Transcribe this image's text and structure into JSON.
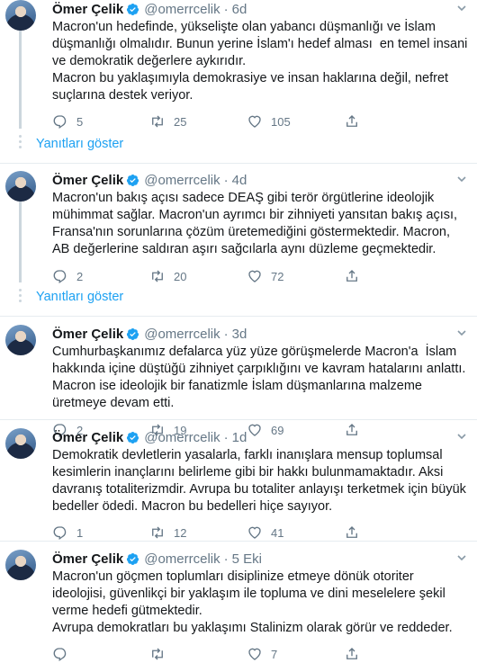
{
  "user": {
    "name": "Ömer Çelik",
    "handle": "@omerrcelik"
  },
  "show_replies_label": "Yanıtları göster",
  "tweets": [
    {
      "time": "6d",
      "text": "Macron'un hedefinde, yükselişte olan yabancı düşmanlığı ve İslam düşmanlığı olmalıdır. Bunun yerine İslam'ı hedef alması  en temel insani ve demokratik değerlere aykırıdır.\nMacron bu yaklaşımıyla demokrasiye ve insan haklarına değil, nefret suçlarına destek veriyor.",
      "replies": "5",
      "retweets": "25",
      "likes": "105"
    },
    {
      "time": "4d",
      "text": "Macron'un bakış açısı sadece DEAŞ gibi terör örgütlerine ideolojik mühimmat sağlar. Macron'un ayrımcı bir zihniyeti yansıtan bakış açısı, Fransa'nın sorunlarına çözüm üretemediğini göstermektedir. Macron, AB değerlerine saldıran aşırı sağcılarla aynı düzleme geçmektedir.",
      "replies": "2",
      "retweets": "20",
      "likes": "72"
    },
    {
      "time": "3d",
      "text": "Cumhurbaşkanımız defalarca yüz yüze görüşmelerde Macron'a  İslam hakkında içine düştüğü zihniyet çarpıklığını ve kavram hatalarını anlattı. Macron ise ideolojik bir fanatizmle İslam düşmanlarına malzeme üretmeye devam etti.",
      "replies": "2",
      "retweets": "19",
      "likes": "69"
    },
    {
      "time": "1d",
      "text": "Demokratik devletlerin yasalarla, farklı inanışlara mensup toplumsal kesimlerin inançlarını belirleme gibi bir hakkı bulunmamaktadır. Aksi davranış totaliterizmdir. Avrupa bu totaliter anlayışı terketmek için büyük bedeller ödedi. Macron bu bedelleri hiçe sayıyor.",
      "replies": "1",
      "retweets": "12",
      "likes": "41"
    },
    {
      "time": "5 Eki",
      "text": "Macron'un göçmen toplumları disiplinize etmeye dönük otoriter ideolojisi, güvenlikçi bir yaklaşım ile topluma ve dini meselelere şekil verme hedefi gütmektedir.\nAvrupa demokratları bu yaklaşımı Stalinizm olarak görür ve reddeder.",
      "replies": "",
      "retweets": "",
      "likes": "7"
    }
  ],
  "colors": {
    "accent": "#1da1f2",
    "muted": "#657786",
    "verified": "#1da1f2",
    "divider": "#e6ecf0"
  },
  "icons": [
    "reply-icon",
    "retweet-icon",
    "like-icon",
    "share-icon",
    "verified-badge-icon",
    "caret-down-icon"
  ]
}
